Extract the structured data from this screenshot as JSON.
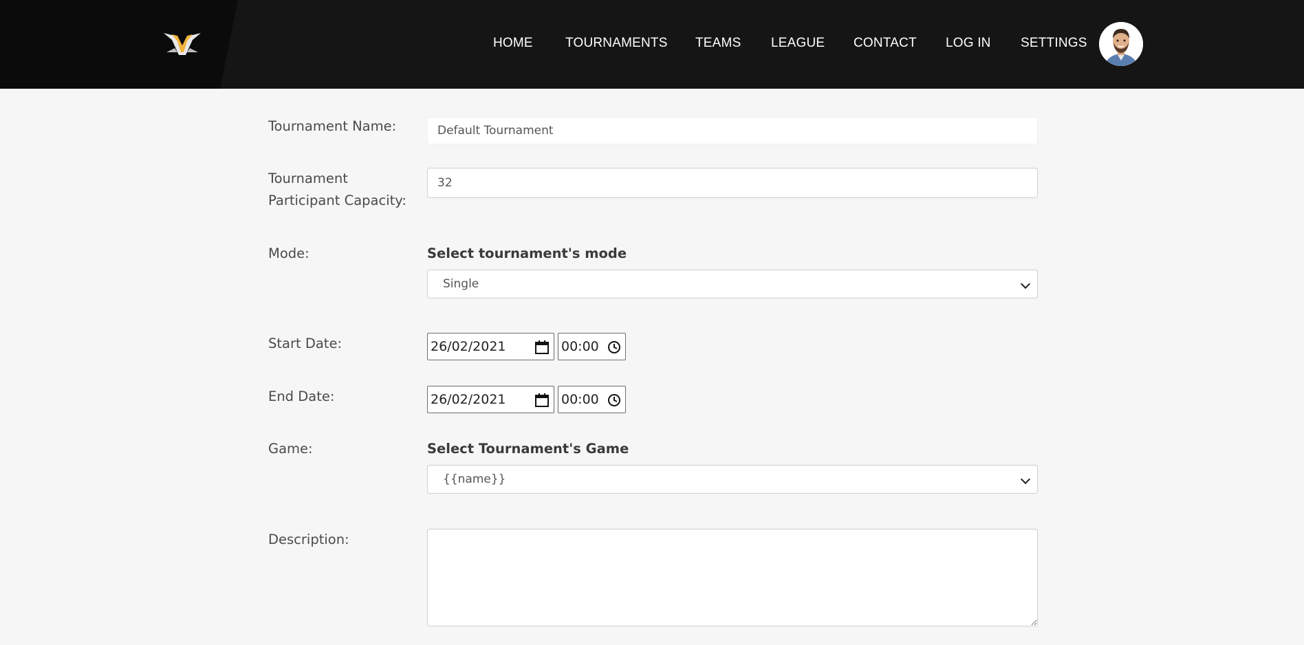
{
  "nav": {
    "items": [
      "HOME",
      "TOURNAMENTS",
      "TEAMS",
      "LEAGUE",
      "CONTACT",
      "LOG IN",
      "SETTINGS"
    ]
  },
  "form": {
    "name_label": "Tournament Name:",
    "name_value": "Default Tournament",
    "capacity_label_line1": "Tournament",
    "capacity_label_line2": "Participant Capacity:",
    "capacity_value": "32",
    "mode_label": "Mode:",
    "mode_title": "Select tournament's mode",
    "mode_selected": "Single",
    "start_label": "Start Date:",
    "start_date": "26/02/2021",
    "start_time": "00:00",
    "end_label": "End Date:",
    "end_date": "26/02/2021",
    "end_time": "00:00",
    "game_label": "Game:",
    "game_title": "Select Tournament's Game",
    "game_selected": "{{name}}",
    "description_label": "Description:",
    "description_value": ""
  },
  "icons": {
    "logo": "winged-v-logo",
    "calendar": "calendar-icon",
    "clock": "clock-icon",
    "chevron": "chevron-down-icon"
  },
  "colors": {
    "header_bg": "#151515",
    "brand_panel_bg": "#0b0b0b",
    "page_bg": "#f6f6f6",
    "logo_accent": "#f2b53a"
  }
}
